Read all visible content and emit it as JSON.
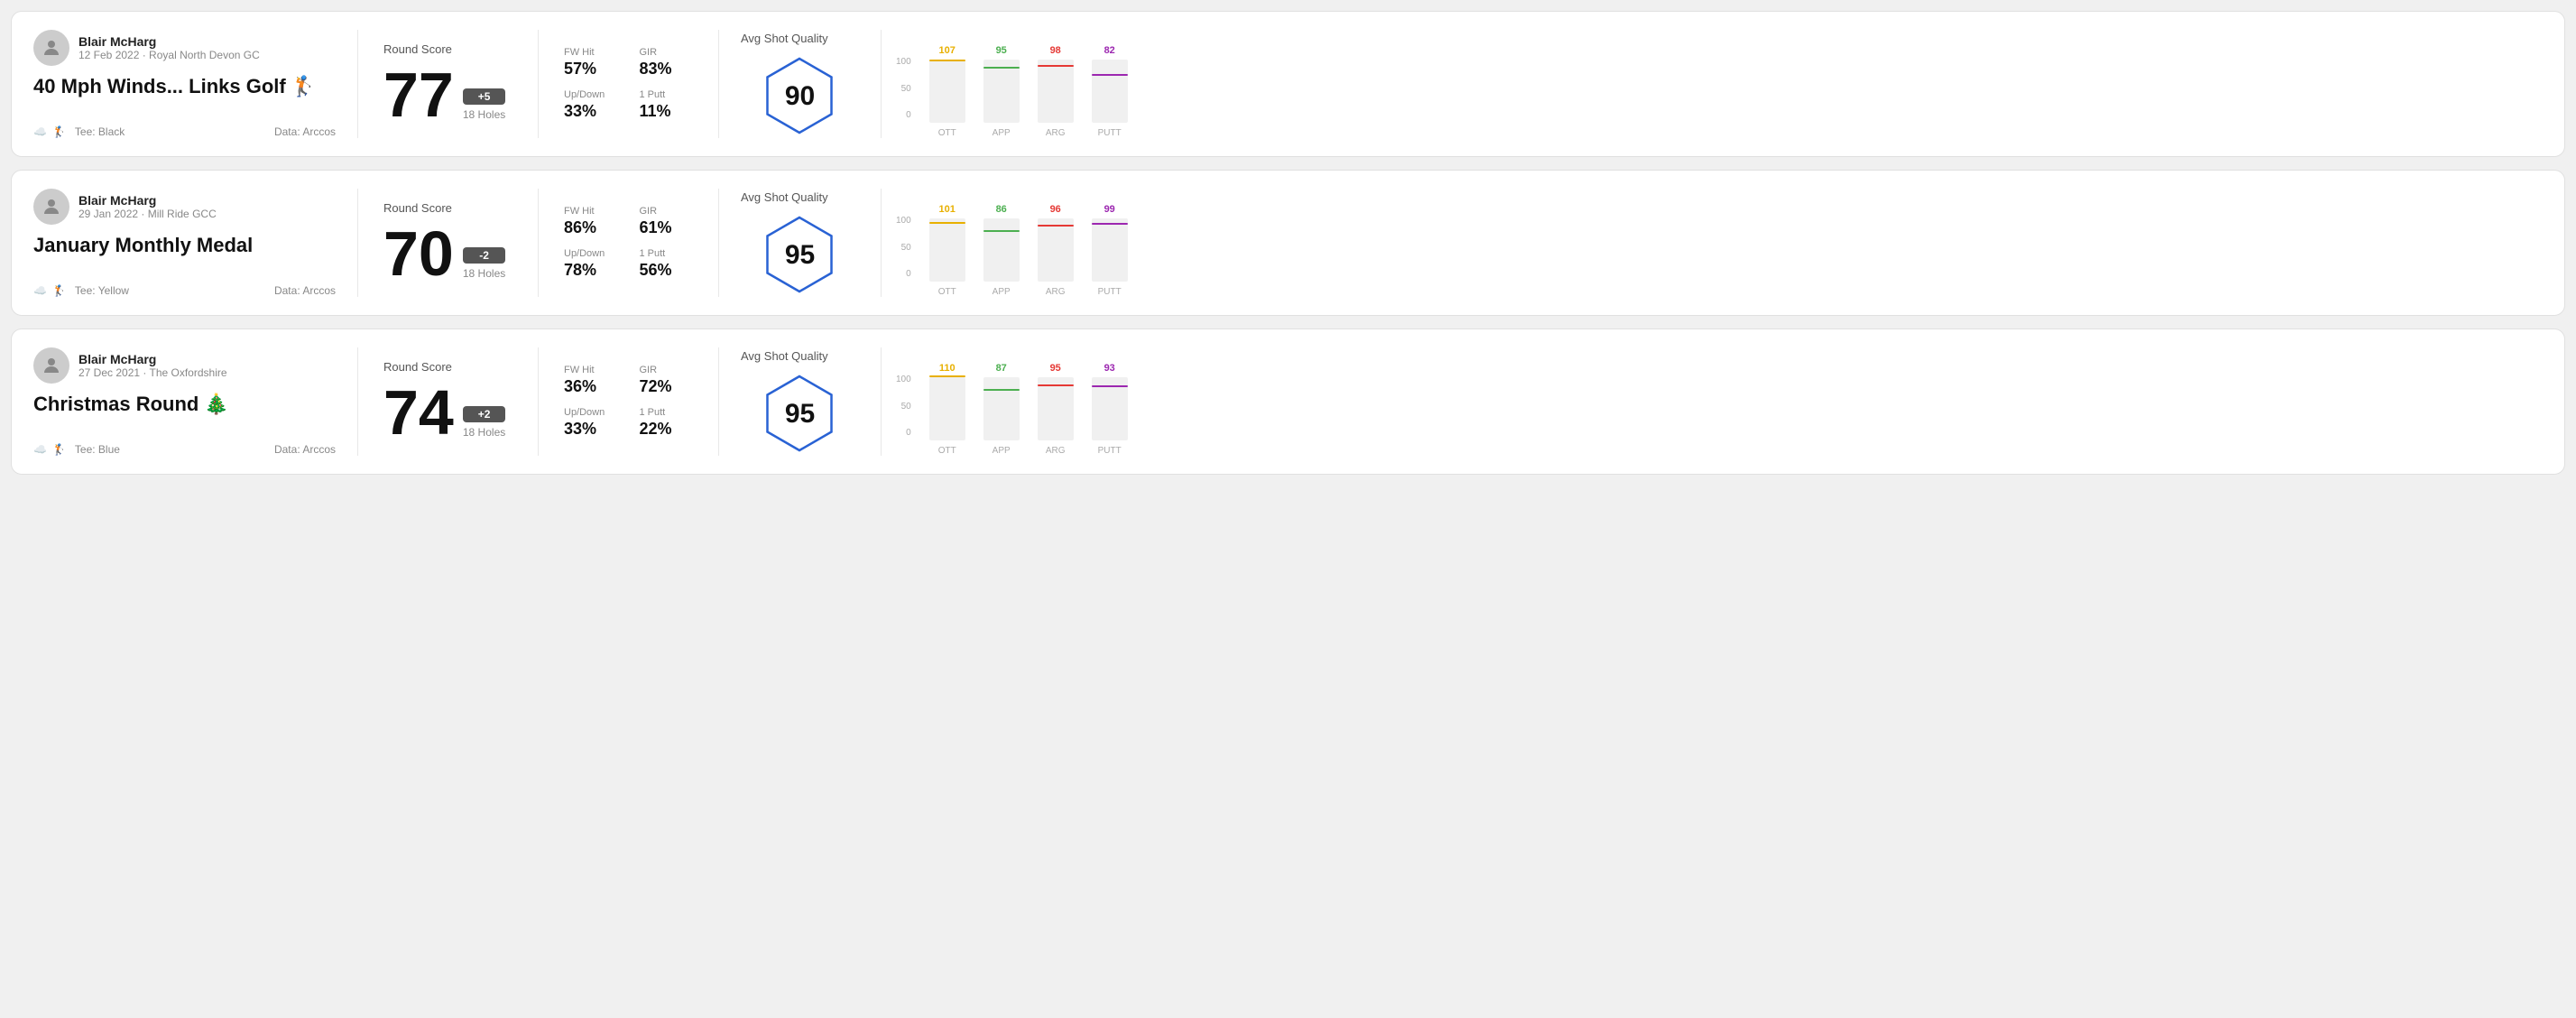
{
  "rounds": [
    {
      "id": "round1",
      "player_name": "Blair McHarg",
      "date": "12 Feb 2022 · Royal North Devon GC",
      "title": "40 Mph Winds... Links Golf",
      "title_emoji": "🏌️",
      "tee": "Black",
      "data_source": "Data: Arccos",
      "score": "77",
      "score_modifier": "+5",
      "score_modifier_type": "plus",
      "holes": "18 Holes",
      "fw_hit": "57%",
      "gir": "83%",
      "up_down": "33%",
      "one_putt": "11%",
      "avg_shot_quality": "90",
      "chart": {
        "bars": [
          {
            "label": "OTT",
            "value": 107,
            "color": "#e8b000"
          },
          {
            "label": "APP",
            "value": 95,
            "color": "#4caf50"
          },
          {
            "label": "ARG",
            "value": 98,
            "color": "#e53935"
          },
          {
            "label": "PUTT",
            "value": 82,
            "color": "#9c27b0"
          }
        ],
        "y_labels": [
          "100",
          "50",
          "0"
        ]
      }
    },
    {
      "id": "round2",
      "player_name": "Blair McHarg",
      "date": "29 Jan 2022 · Mill Ride GCC",
      "title": "January Monthly Medal",
      "title_emoji": "",
      "tee": "Yellow",
      "data_source": "Data: Arccos",
      "score": "70",
      "score_modifier": "-2",
      "score_modifier_type": "minus",
      "holes": "18 Holes",
      "fw_hit": "86%",
      "gir": "61%",
      "up_down": "78%",
      "one_putt": "56%",
      "avg_shot_quality": "95",
      "chart": {
        "bars": [
          {
            "label": "OTT",
            "value": 101,
            "color": "#e8b000"
          },
          {
            "label": "APP",
            "value": 86,
            "color": "#4caf50"
          },
          {
            "label": "ARG",
            "value": 96,
            "color": "#e53935"
          },
          {
            "label": "PUTT",
            "value": 99,
            "color": "#9c27b0"
          }
        ],
        "y_labels": [
          "100",
          "50",
          "0"
        ]
      }
    },
    {
      "id": "round3",
      "player_name": "Blair McHarg",
      "date": "27 Dec 2021 · The Oxfordshire",
      "title": "Christmas Round",
      "title_emoji": "🎄",
      "tee": "Blue",
      "data_source": "Data: Arccos",
      "score": "74",
      "score_modifier": "+2",
      "score_modifier_type": "plus",
      "holes": "18 Holes",
      "fw_hit": "36%",
      "gir": "72%",
      "up_down": "33%",
      "one_putt": "22%",
      "avg_shot_quality": "95",
      "chart": {
        "bars": [
          {
            "label": "OTT",
            "value": 110,
            "color": "#e8b000"
          },
          {
            "label": "APP",
            "value": 87,
            "color": "#4caf50"
          },
          {
            "label": "ARG",
            "value": 95,
            "color": "#e53935"
          },
          {
            "label": "PUTT",
            "value": 93,
            "color": "#9c27b0"
          }
        ],
        "y_labels": [
          "100",
          "50",
          "0"
        ]
      }
    }
  ],
  "labels": {
    "round_score": "Round Score",
    "fw_hit": "FW Hit",
    "gir": "GIR",
    "up_down": "Up/Down",
    "one_putt": "1 Putt",
    "avg_shot_quality": "Avg Shot Quality"
  }
}
